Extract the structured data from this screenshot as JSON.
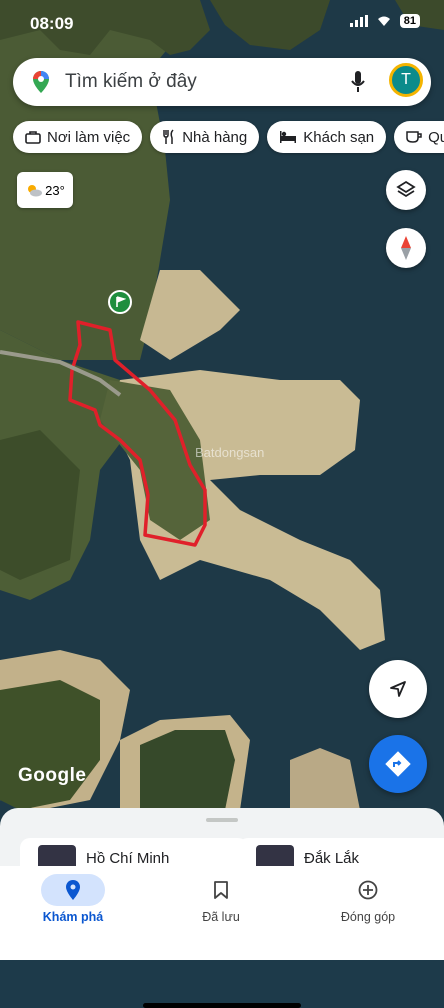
{
  "status": {
    "time": "08:09",
    "battery": "81"
  },
  "search": {
    "placeholder": "Tìm kiếm ở đây",
    "avatar_letter": "T"
  },
  "chips": [
    {
      "label": "Nơi làm việc",
      "icon": "briefcase-icon"
    },
    {
      "label": "Nhà hàng",
      "icon": "restaurant-icon"
    },
    {
      "label": "Khách sạn",
      "icon": "hotel-icon"
    },
    {
      "label": "Qu",
      "icon": "cafe-icon"
    }
  ],
  "weather": {
    "temp": "23°",
    "icon": "partly-cloudy-icon"
  },
  "map": {
    "attribution": "Google",
    "watermark": "Batdongsan"
  },
  "sheet": {
    "cards": [
      {
        "label": "Hồ Chí Minh"
      },
      {
        "label": "Đắk Lắk"
      }
    ]
  },
  "nav": {
    "explore": "Khám phá",
    "saved": "Đã lưu",
    "contribute": "Đóng góp"
  },
  "colors": {
    "accent": "#1a73e8",
    "boundary": "#e0202a",
    "water": "#1d3a4a"
  }
}
